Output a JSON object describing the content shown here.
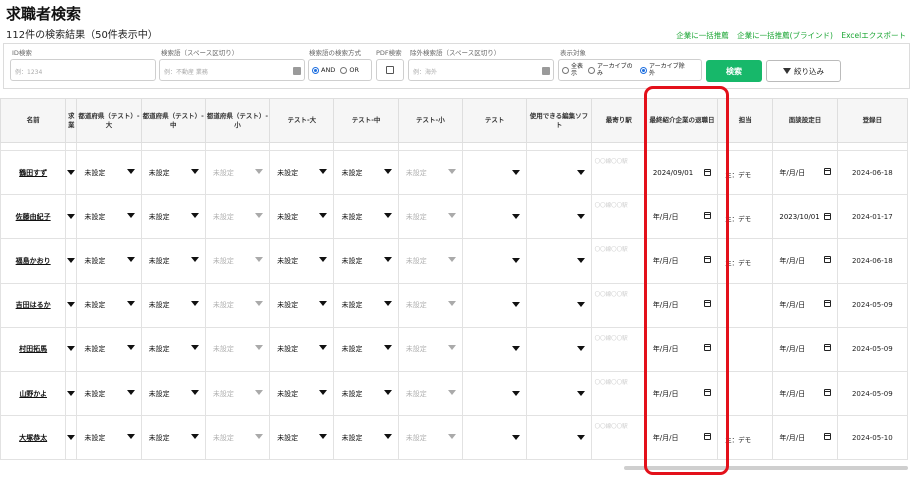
{
  "page": {
    "title": "求職者検索",
    "result_count": "112件の検索結果（50件表示中）"
  },
  "links": {
    "bulk_recommend": "企業に一括推薦",
    "bulk_recommend_blind": "企業に一括推薦(ブラインド)",
    "excel_export": "Excelエクスポート"
  },
  "filters": {
    "id": {
      "label": "ID検索",
      "placeholder": "例：1234"
    },
    "keyword": {
      "label": "検索語（スペース区切り）",
      "placeholder": "例：不動産 業務"
    },
    "method": {
      "label": "検索語の検索方式",
      "and": "AND",
      "or": "OR",
      "selected": "AND"
    },
    "pdf": {
      "label": "PDF検索"
    },
    "exclude": {
      "label": "除外検索語（スペース区切り）",
      "placeholder": "例：海外"
    },
    "target": {
      "label": "表示対象",
      "opt_all": "全表示",
      "opt_archive_only": "アーカイブのみ",
      "opt_archive_exclude": "アーカイブ除外",
      "selected": "アーカイブ除外"
    },
    "search_button": "検索",
    "filter_button": "絞り込み"
  },
  "table": {
    "headers": {
      "name": "名前",
      "c1": "求\n業",
      "pref_large": "都道府県（テスト）-大",
      "pref_mid": "都道府県（テスト）-中",
      "pref_small": "都道府県（テスト）-小",
      "test_large": "テスト-大",
      "test_mid": "テスト-中",
      "test_small": "テスト-小",
      "test": "テスト",
      "software": "使用できる編集ソフト",
      "station": "最寄り駅",
      "last_intro": "最終紹介企業の退職日",
      "tanto": "担当",
      "interview_date": "面談設定日",
      "registered": "登録日"
    },
    "unset": "未設定",
    "station_placeholder": "〇〇線〇〇駅",
    "rows": [
      {
        "name": "鶴田すず",
        "last_intro": "2024/09/01",
        "tanto": "主：デモ",
        "interview": "年/月/日",
        "registered": "2024-06-18"
      },
      {
        "name": "佐藤由紀子",
        "last_intro": "年/月/日",
        "tanto": "主：デモ",
        "interview": "2023/10/01",
        "registered": "2024-01-17"
      },
      {
        "name": "福島かおり",
        "last_intro": "年/月/日",
        "tanto": "主：デモ",
        "interview": "年/月/日",
        "registered": "2024-06-18"
      },
      {
        "name": "吉田はるか",
        "last_intro": "年/月/日",
        "tanto": "",
        "interview": "年/月/日",
        "registered": "2024-05-09"
      },
      {
        "name": "村田拓馬",
        "last_intro": "年/月/日",
        "tanto": "",
        "interview": "年/月/日",
        "registered": "2024-05-09"
      },
      {
        "name": "山野かよ",
        "last_intro": "年/月/日",
        "tanto": "",
        "interview": "年/月/日",
        "registered": "2024-05-09"
      },
      {
        "name": "大塚恭太",
        "last_intro": "年/月/日",
        "tanto": "主：デモ",
        "interview": "年/月/日",
        "registered": "2024-05-10"
      }
    ]
  }
}
